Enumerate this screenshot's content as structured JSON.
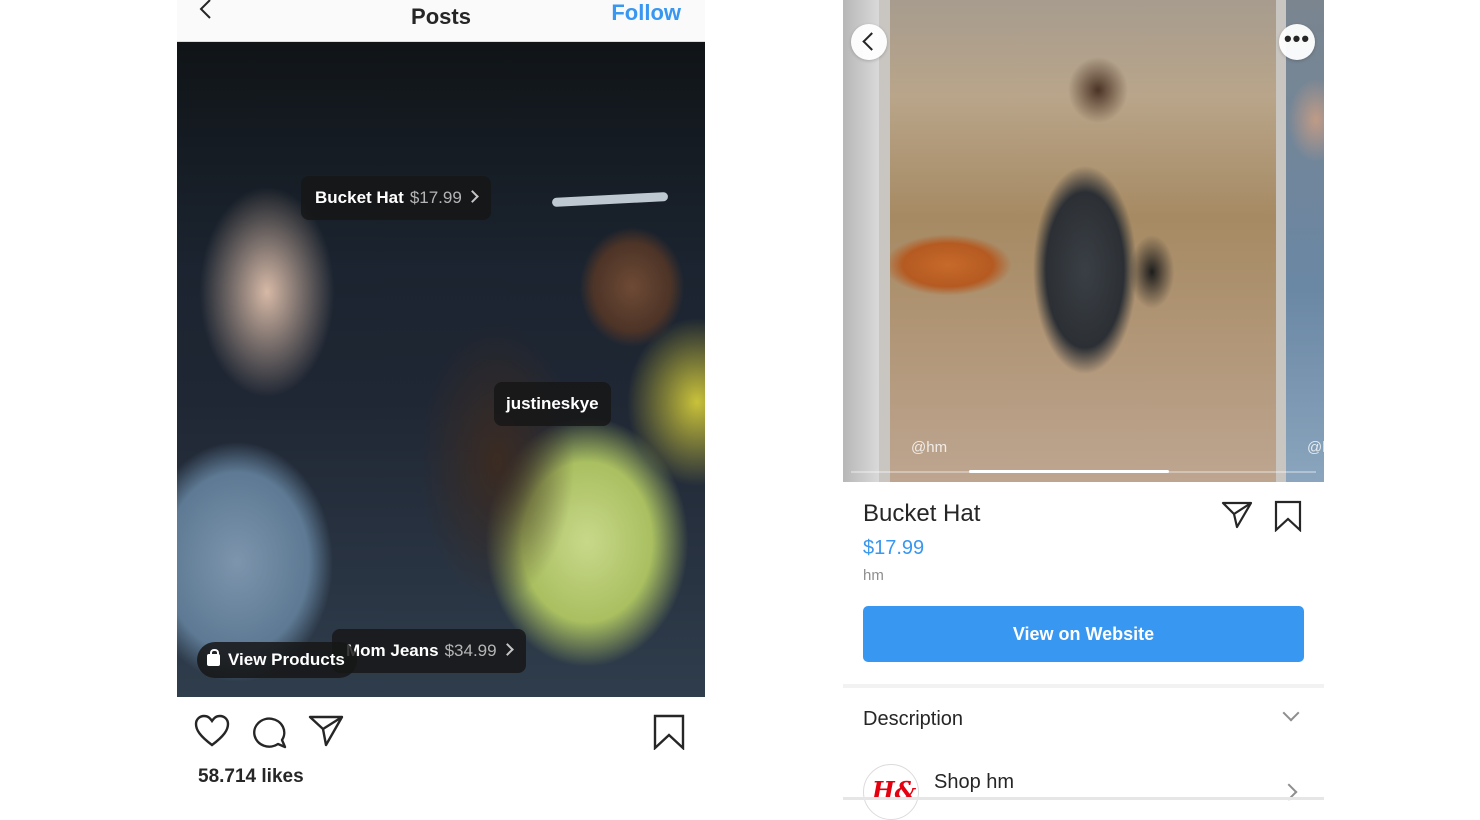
{
  "left_post": {
    "title": "Posts",
    "follow_label": "Follow",
    "tags": {
      "bucket_hat": {
        "name": "Bucket Hat",
        "price": "$17.99"
      },
      "user": {
        "name": "justineskye"
      },
      "mom_jeans": {
        "name": "Mom Jeans",
        "price": "$34.99"
      }
    },
    "view_products_label": "View Products",
    "likes": "58.714 likes",
    "icons": [
      "back-chevron-icon",
      "heart-icon",
      "comment-icon",
      "share-icon",
      "bookmark-icon",
      "shopping-bag-icon"
    ]
  },
  "right_product": {
    "watermark": "@hm",
    "watermark_next": "@h",
    "name": "Bucket Hat",
    "price": "$17.99",
    "brand": "hm",
    "cta_label": "View on Website",
    "description_label": "Description",
    "shop_label": "Shop hm",
    "shop_logo_text": "H&M",
    "colors": {
      "accent": "#3897f0",
      "text": "#262626",
      "muted": "#8e8e8e",
      "hm_red": "#e50010"
    }
  }
}
